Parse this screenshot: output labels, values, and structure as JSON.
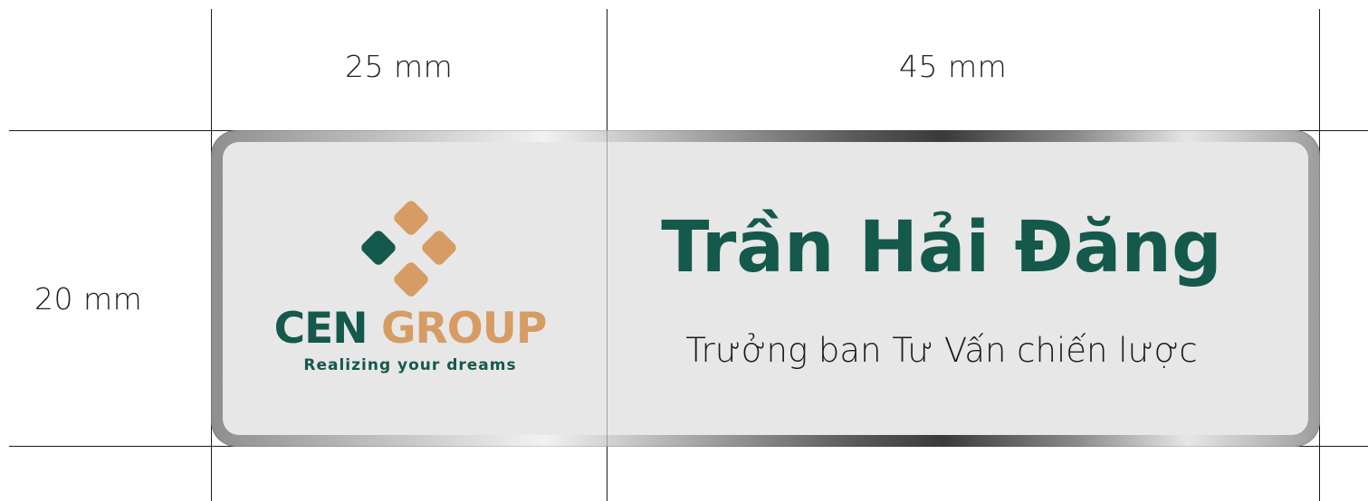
{
  "dimensions": {
    "logo_width": "25 mm",
    "text_width": "45 mm",
    "height": "20 mm"
  },
  "badge": {
    "logo": {
      "brand_primary": "CEN",
      "brand_secondary": "GROUP",
      "tagline": "Realizing your dreams",
      "icon": "four-diamond-logo-icon"
    },
    "name": "Trần Hải Đăng",
    "title": "Trưởng ban Tư Vấn chiến lược"
  },
  "colors": {
    "brand_green": "#14594b",
    "brand_gold": "#d79c63",
    "plate_fill": "#e7e7e7",
    "frame": "silver-metallic"
  }
}
